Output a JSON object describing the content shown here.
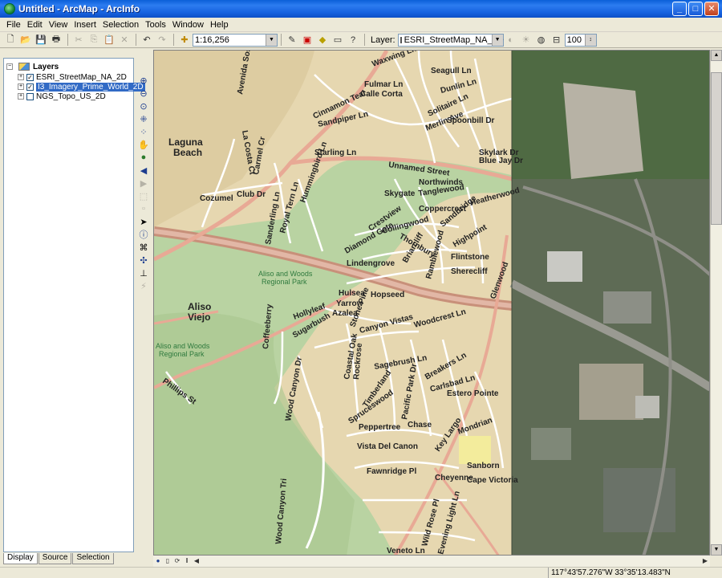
{
  "window": {
    "title": "Untitled - ArcMap - ArcInfo"
  },
  "menu": [
    "File",
    "Edit",
    "View",
    "Insert",
    "Selection",
    "Tools",
    "Window",
    "Help"
  ],
  "toolbar": {
    "scale_value": "1:16,256",
    "layer_label": "Layer:",
    "layer_value": "ESRI_StreetMap_NA_2D",
    "transparency_value": "100"
  },
  "toc": {
    "root_label": "Layers",
    "layers": [
      {
        "name": "ESRI_StreetMap_NA_2D",
        "checked": true,
        "selected": false
      },
      {
        "name": "I3_Imagery_Prime_World_2D",
        "checked": true,
        "selected": true
      },
      {
        "name": "NGS_Topo_US_2D",
        "checked": false,
        "selected": false
      }
    ],
    "tabs": [
      "Display",
      "Source",
      "Selection"
    ]
  },
  "map": {
    "places": {
      "laguna_1": "Laguna",
      "laguna_2": "Beach",
      "aliso_1": "Aliso",
      "aliso_2": "Viejo",
      "park1_1": "Aliso and Woods",
      "park1_2": "Regional Park",
      "park2_1": "Aliso and Woods",
      "park2_2": "Regional Park"
    },
    "streets": [
      "Cinnamon Teal",
      "Sandpiper Ln",
      "Fulmar Ln",
      "Calle Corta",
      "Waxwing Ln",
      "Seagull Ln",
      "Dunlin Ln",
      "Solitaire Ln",
      "Merlin Ave",
      "Spoonbill Dr",
      "Skylark Dr",
      "Blue Jay Dr",
      "Unnamed Street",
      "Starling Ln",
      "Club Dr",
      "Cozumel",
      "Carmel Cr",
      "La Costa Ct",
      "Royal Tern Ln",
      "Hummingbird Ln",
      "Sanderling Ln",
      "Northwinds",
      "Tanglewood",
      "Skygate",
      "Heatherwood",
      "Coppercrest",
      "Crestview",
      "Collingwood",
      "Diamond Gate",
      "Thornbury",
      "Sandbridge",
      "Highpoint",
      "Flintstone",
      "Lindengrove",
      "Briarcliff",
      "Sherecliff",
      "Ramblewood",
      "Hopseed",
      "Hulsea",
      "Yarrow",
      "Azalea",
      "Hollyleaf",
      "Sugarbush",
      "Stone Pine",
      "Canyon Vistas",
      "Woodcrest Ln",
      "Coffeeberry",
      "Coastal Oak",
      "Rockrose",
      "Sagebrush Ln",
      "Breakers Ln",
      "Carlsbad Ln",
      "Estero Pointe",
      "Spruceswood",
      "Timberland",
      "Peppertree",
      "Chase",
      "Vista Del Canon",
      "Key Largo",
      "Mondrian",
      "Sanborn",
      "Fawnridge Pl",
      "Cheyenne",
      "Cape Victoria",
      "Wood Canyon Dr",
      "Wood Canyon Tri",
      "Phillips St",
      "Glenwood",
      "Wild Rose Pl",
      "Veneto Ln",
      "Evening Light Ln",
      "Pacific Park Dr",
      "Avenida Sosiego"
    ]
  },
  "status": {
    "coordinates": "117°43'57.276\"W  33°35'13.483\"N"
  }
}
